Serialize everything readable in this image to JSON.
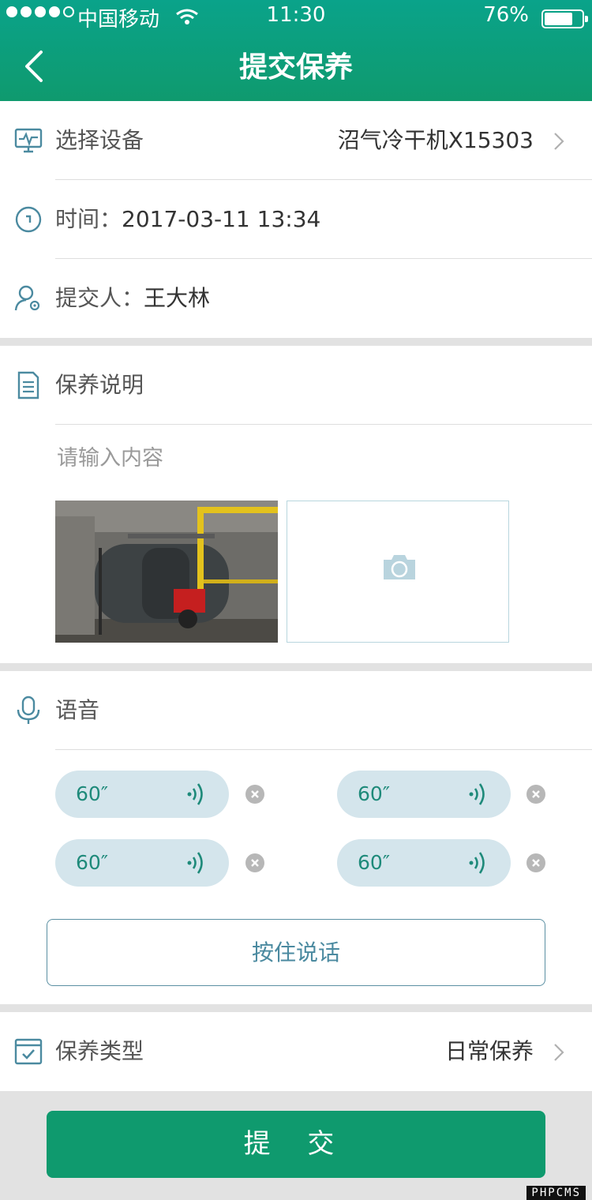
{
  "status_bar": {
    "carrier": "中国移动",
    "time": "11:30",
    "battery_pct": "76%",
    "battery_level": 0.76
  },
  "nav": {
    "title": "提交保养",
    "back_icon": "chevron-left-icon"
  },
  "form": {
    "device": {
      "label": "选择设备",
      "value": "沼气冷干机X15303",
      "icon": "monitor-pulse-icon"
    },
    "time": {
      "label": "时间：",
      "value": "2017-03-11 13:34",
      "icon": "clock-icon"
    },
    "submitter": {
      "label": "提交人：",
      "value": "王大林",
      "icon": "user-gear-icon"
    },
    "description": {
      "label": "保养说明",
      "icon": "document-icon",
      "placeholder": "请输入内容",
      "photo_icon": "camera-icon"
    },
    "voice": {
      "label": "语音",
      "icon": "microphone-icon",
      "clips": [
        {
          "duration": "60″"
        },
        {
          "duration": "60″"
        },
        {
          "duration": "60″"
        },
        {
          "duration": "60″"
        }
      ],
      "talk_button": "按住说话"
    },
    "type": {
      "label": "保养类型",
      "value": "日常保养",
      "icon": "calendar-check-icon"
    }
  },
  "submit_label": "提 交",
  "watermark": "PHPCMS",
  "colors": {
    "primary_green": "#0f9a6e",
    "icon_teal": "#4b8aa0",
    "voice_bubble": "#d4e5ec",
    "page_gray": "#e2e2e2"
  }
}
